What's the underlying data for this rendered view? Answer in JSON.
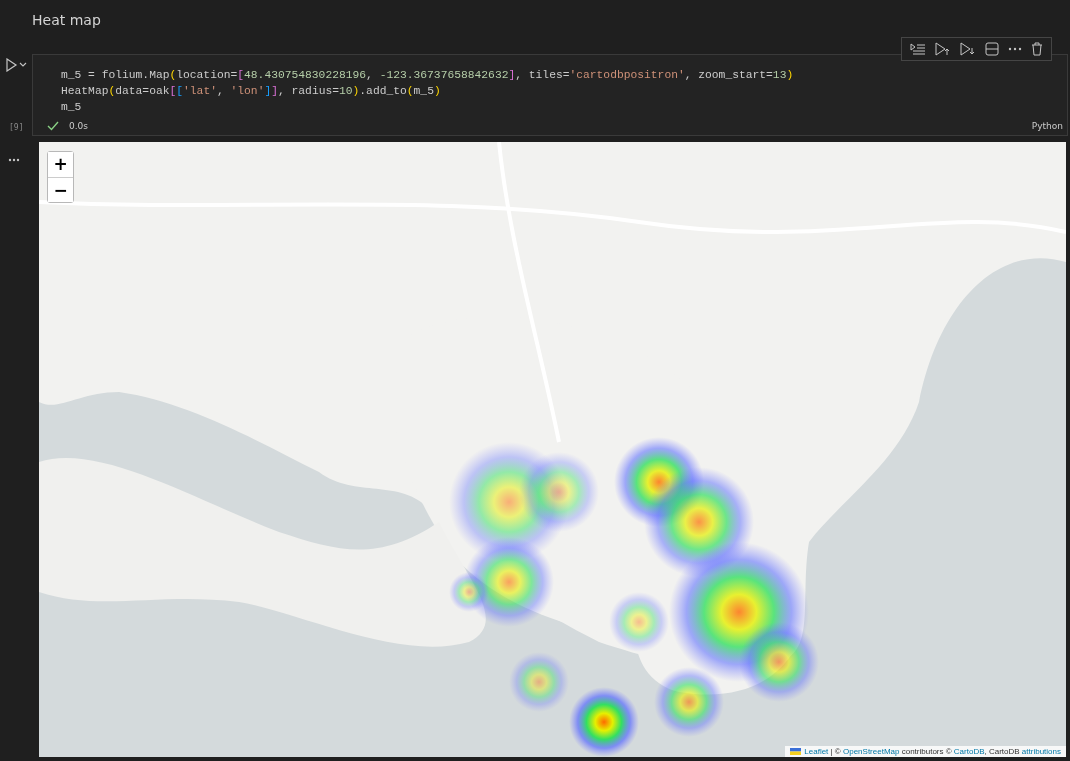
{
  "markdown": {
    "heading": "Heat map"
  },
  "cell": {
    "execution_count": "[9]",
    "language": "Python",
    "status": {
      "success": true,
      "duration": "0.0s"
    },
    "code_lines": [
      [
        {
          "kind": "plain",
          "text": "m_5 = folium.Map"
        },
        {
          "kind": "paren",
          "text": "("
        },
        {
          "kind": "plain",
          "text": "location="
        },
        {
          "kind": "bracket",
          "text": "["
        },
        {
          "kind": "number",
          "text": "48.430754830228196"
        },
        {
          "kind": "plain",
          "text": ", "
        },
        {
          "kind": "number",
          "text": "-123.36737658842632"
        },
        {
          "kind": "bracket",
          "text": "]"
        },
        {
          "kind": "plain",
          "text": ", tiles="
        },
        {
          "kind": "string",
          "text": "'cartodbpositron'"
        },
        {
          "kind": "plain",
          "text": ", zoom_start="
        },
        {
          "kind": "number",
          "text": "13"
        },
        {
          "kind": "paren",
          "text": ")"
        }
      ],
      [
        {
          "kind": "plain",
          "text": "HeatMap"
        },
        {
          "kind": "paren",
          "text": "("
        },
        {
          "kind": "plain",
          "text": "data=oak"
        },
        {
          "kind": "bracket",
          "text": "["
        },
        {
          "kind": "bracket2",
          "text": "["
        },
        {
          "kind": "string",
          "text": "'lat'"
        },
        {
          "kind": "plain",
          "text": ", "
        },
        {
          "kind": "string",
          "text": "'lon'"
        },
        {
          "kind": "bracket2",
          "text": "]"
        },
        {
          "kind": "bracket",
          "text": "]"
        },
        {
          "kind": "plain",
          "text": ", radius="
        },
        {
          "kind": "number",
          "text": "10"
        },
        {
          "kind": "paren",
          "text": ")"
        },
        {
          "kind": "plain",
          "text": ".add_to"
        },
        {
          "kind": "paren",
          "text": "("
        },
        {
          "kind": "plain",
          "text": "m_5"
        },
        {
          "kind": "paren",
          "text": ")"
        }
      ],
      [
        {
          "kind": "plain",
          "text": "m_5"
        }
      ]
    ]
  },
  "output": {
    "map": {
      "zoom_in": "+",
      "zoom_out": "−",
      "attribution": [
        {
          "kind": "link",
          "text": "Leaflet"
        },
        {
          "kind": "text",
          "text": " | © "
        },
        {
          "kind": "link",
          "text": "OpenStreetMap"
        },
        {
          "kind": "text",
          "text": " contributors © "
        },
        {
          "kind": "link",
          "text": "CartoDB"
        },
        {
          "kind": "text",
          "text": ", CartoDB "
        },
        {
          "kind": "link",
          "text": "attributions"
        }
      ]
    }
  }
}
